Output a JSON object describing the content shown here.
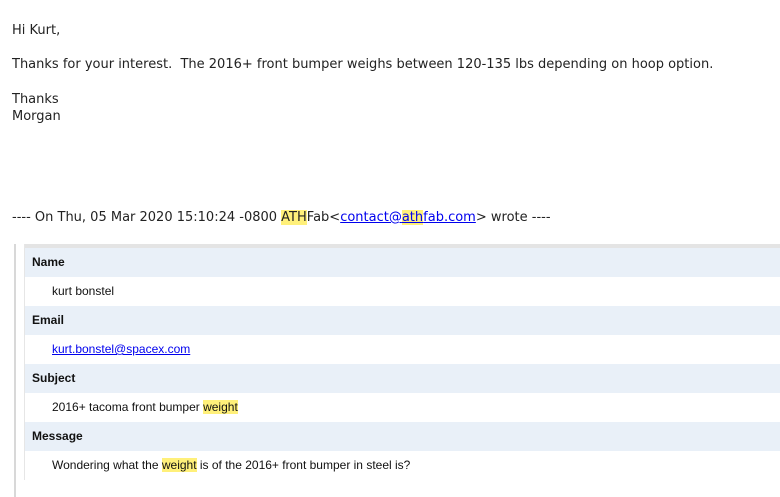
{
  "email": {
    "greeting": "Hi Kurt,",
    "body": "Thanks for your interest.  The 2016+ front bumper weighs between 120-135 lbs depending on hoop option.",
    "signoff": "Thanks",
    "signature": "Morgan"
  },
  "quote_header": {
    "prefix": "---- On Thu, 05 Mar 2020 15:10:24 -0800 ",
    "sender_hl": "ATH",
    "sender_rest": "Fab<",
    "email_a": "contact@",
    "email_hl": "ath",
    "email_b": "fab.com",
    "suffix": "> wrote ----"
  },
  "form": {
    "name_label": "Name",
    "name_value": "kurt bonstel",
    "email_label": "Email",
    "email_value": "kurt.bonstel@spacex.com",
    "subject_label": "Subject",
    "subject_pre": "2016+ tacoma front bumper ",
    "subject_hl": "weight",
    "message_label": "Message",
    "message_pre": "Wondering what the ",
    "message_hl": "weight",
    "message_post": " is of the 2016+ front bumper in steel is?"
  },
  "colors": {
    "highlight": "#fff07a",
    "label_row_bg": "#e9f0f8",
    "link": "#0000ee"
  }
}
